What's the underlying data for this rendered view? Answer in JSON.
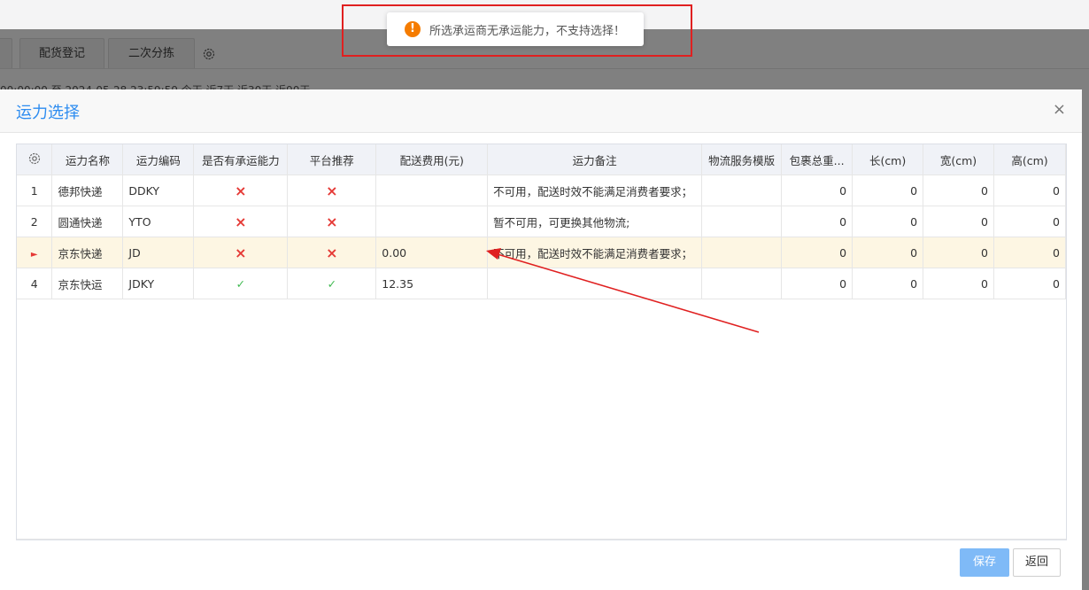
{
  "background": {
    "tabs": [
      "",
      "配货登记",
      "二次分拣"
    ],
    "filter_text": "00:00:00  至  2024-05-28 23:59:59    今天  近7天  近30天  近90天"
  },
  "toast": {
    "message": "所选承运商无承运能力，不支持选择！",
    "icon": "warning-icon",
    "icon_color": "#f57c00"
  },
  "dialog": {
    "title": "运力选择",
    "close": "×",
    "columns": [
      "运力名称",
      "运力编码",
      "是否有承运能力",
      "平台推荐",
      "配送费用(元)",
      "运力备注",
      "物流服务模版",
      "包裹总重...",
      "长(cm)",
      "宽(cm)",
      "高(cm)"
    ],
    "rows": [
      {
        "index": "1",
        "name": "德邦快递",
        "code": "DDKY",
        "capable": "×",
        "recommended": "×",
        "fee": "",
        "remark": "不可用，配送时效不能满足消费者要求；",
        "template": "",
        "weight": "0",
        "length": "0",
        "width": "0",
        "height": "0"
      },
      {
        "index": "2",
        "name": "圆通快递",
        "code": "YTO",
        "capable": "×",
        "recommended": "×",
        "fee": "",
        "remark": "暂不可用，可更换其他物流;",
        "template": "",
        "weight": "0",
        "length": "0",
        "width": "0",
        "height": "0"
      },
      {
        "index": "►",
        "name": "京东快递",
        "code": "JD",
        "capable": "×",
        "recommended": "×",
        "fee": "0.00",
        "remark": "不可用，配送时效不能满足消费者要求；",
        "template": "",
        "weight": "0",
        "length": "0",
        "width": "0",
        "height": "0"
      },
      {
        "index": "4",
        "name": "京东快运",
        "code": "JDKY",
        "capable": "✓",
        "recommended": "✓",
        "fee": "12.35",
        "remark": "",
        "template": "",
        "weight": "0",
        "length": "0",
        "width": "0",
        "height": "0"
      }
    ],
    "buttons": {
      "save": "保存",
      "back": "返回"
    }
  },
  "colors": {
    "accent": "#2d8cf0",
    "cross": "#e53935",
    "check": "#3fb950",
    "selected_row": "#fdf6e3",
    "annotation": "#e02020"
  }
}
